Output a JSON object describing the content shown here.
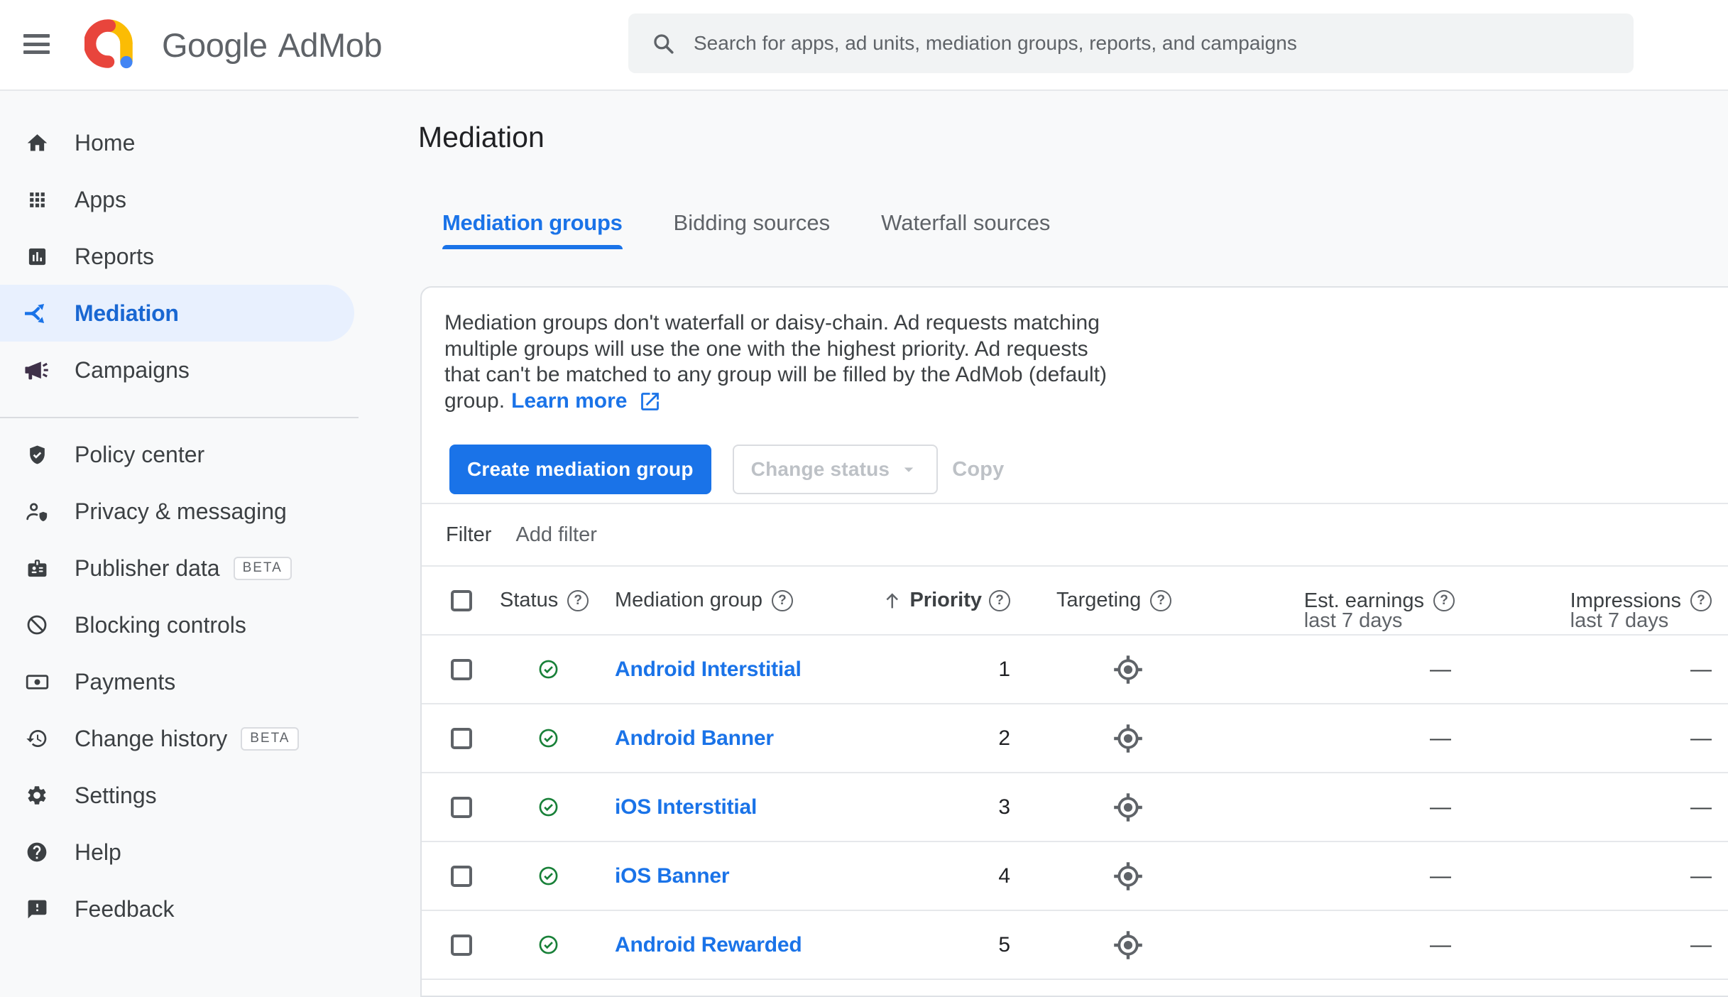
{
  "colors": {
    "accent_blue": "#1a73e8",
    "selected_nav_blue": "#1967d2",
    "status_green": "#188038",
    "content_background": "#f8f9fa",
    "selected_pill": "#e8f0fe",
    "disabled_text": "#bdc1c6"
  },
  "header": {
    "brand_primary": "Google",
    "brand_secondary": "AdMob",
    "search_placeholder": "Search for apps, ad units, mediation groups, reports, and campaigns"
  },
  "sidebar": {
    "primary": [
      {
        "label": "Home"
      },
      {
        "label": "Apps"
      },
      {
        "label": "Reports"
      },
      {
        "label": "Mediation",
        "selected": true
      },
      {
        "label": "Campaigns"
      }
    ],
    "secondary": [
      {
        "label": "Policy center"
      },
      {
        "label": "Privacy & messaging"
      },
      {
        "label": "Publisher data",
        "badge": "BETA"
      },
      {
        "label": "Blocking controls"
      },
      {
        "label": "Payments"
      },
      {
        "label": "Change history",
        "badge": "BETA"
      },
      {
        "label": "Settings"
      },
      {
        "label": "Help"
      },
      {
        "label": "Feedback"
      }
    ]
  },
  "main": {
    "title": "Mediation",
    "tabs": [
      {
        "label": "Mediation groups",
        "active": true
      },
      {
        "label": "Bidding sources"
      },
      {
        "label": "Waterfall sources"
      }
    ],
    "info": {
      "lines": [
        "Mediation groups don't waterfall or daisy-chain. Ad requests matching",
        "multiple groups will use the one with the highest priority. Ad requests",
        "that can't be matched to any group will be filled by the AdMob (default)",
        "group."
      ],
      "learn_more": "Learn more"
    },
    "actions": {
      "create": "Create mediation group",
      "change_status": "Change status",
      "copy": "Copy"
    },
    "filter": {
      "label": "Filter",
      "add_filter": "Add filter"
    },
    "table": {
      "header": {
        "status": "Status",
        "group": "Mediation group",
        "priority": "Priority",
        "targeting": "Targeting",
        "earnings": "Est. earnings",
        "impressions": "Impressions",
        "period": "last 7 days"
      },
      "rows": [
        {
          "name": "Android Interstitial",
          "priority": "1",
          "earnings": "—",
          "impressions": "—"
        },
        {
          "name": "Android Banner",
          "priority": "2",
          "earnings": "—",
          "impressions": "—"
        },
        {
          "name": "iOS Interstitial",
          "priority": "3",
          "earnings": "—",
          "impressions": "—"
        },
        {
          "name": "iOS Banner",
          "priority": "4",
          "earnings": "—",
          "impressions": "—"
        },
        {
          "name": "Android Rewarded",
          "priority": "5",
          "earnings": "—",
          "impressions": "—"
        }
      ]
    }
  }
}
